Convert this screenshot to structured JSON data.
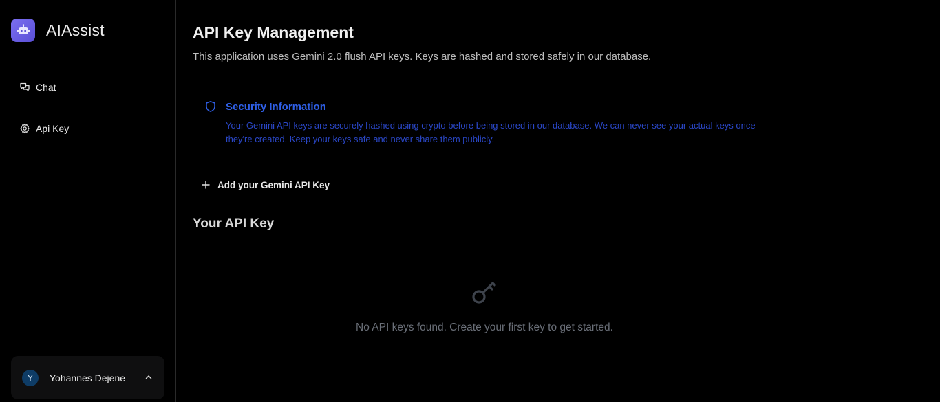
{
  "brand": {
    "name": "AIAssist"
  },
  "sidebar": {
    "items": [
      {
        "label": "Chat",
        "icon": "chat-bubbles-icon"
      },
      {
        "label": "Api Key",
        "icon": "gear-icon"
      }
    ]
  },
  "user": {
    "initial": "Y",
    "name": "Yohannes Dejene"
  },
  "page": {
    "title": "API Key Management",
    "description": "This application uses Gemini 2.0 flush API keys. Keys are hashed and stored safely in our database."
  },
  "security": {
    "title": "Security Information",
    "body": "Your Gemini API keys are securely hashed using crypto before being stored in our database. We can never see your actual keys once they're created. Keep your keys safe and never share them publicly."
  },
  "actions": {
    "add_key_label": "Add your Gemini API Key"
  },
  "keys_section": {
    "title": "Your API Key",
    "empty_text": "No API keys found. Create your first key to get started."
  },
  "colors": {
    "accent": "#2f5fe6",
    "logo": "#6b5fe6",
    "avatar": "#0e3c66",
    "muted": "#6a6f78"
  }
}
